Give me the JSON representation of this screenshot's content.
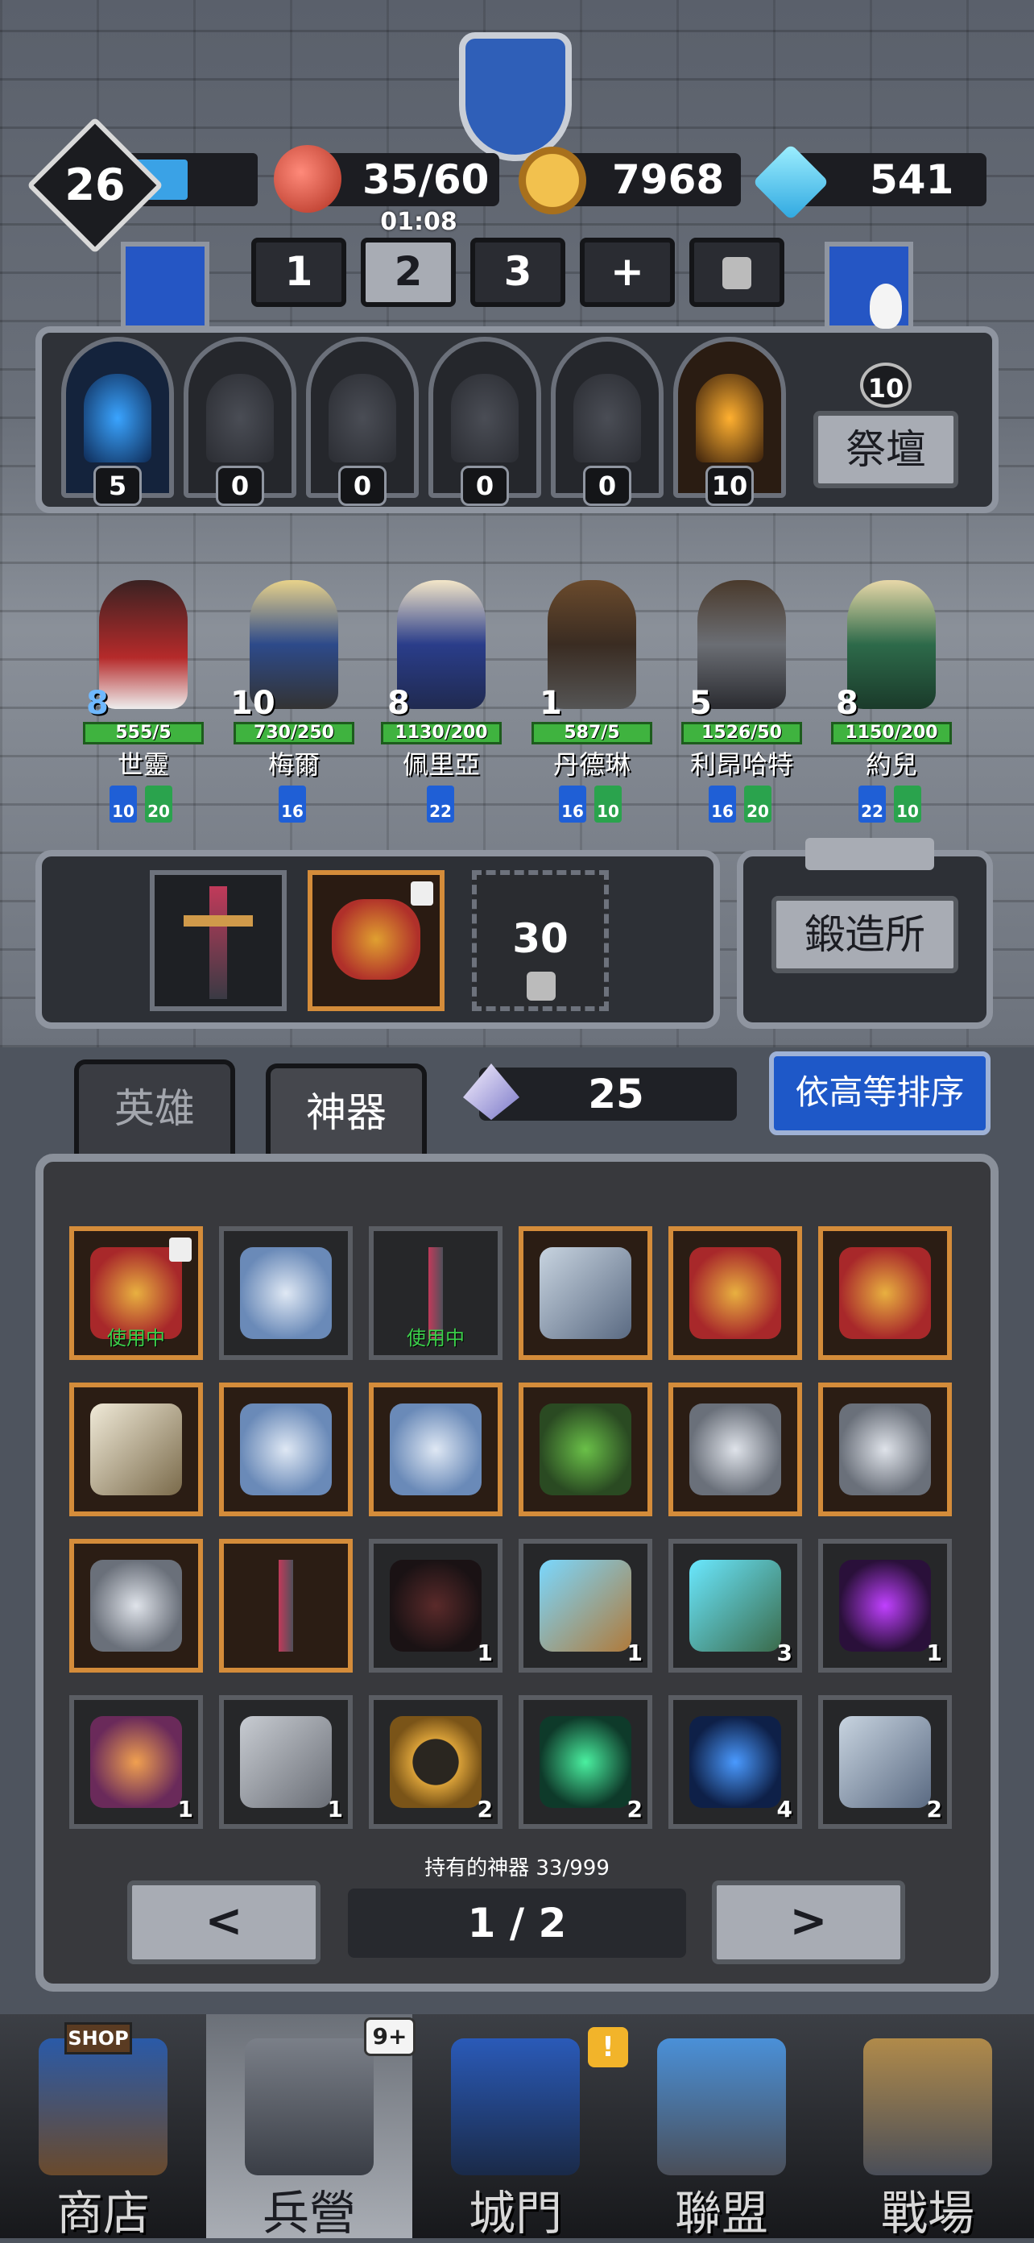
{
  "player": {
    "level": "26",
    "xp_fraction": 0.55
  },
  "resources": {
    "meat": "35/60",
    "meat_timer": "01:08",
    "coins": "7968",
    "gems": "541"
  },
  "teams": {
    "tabs": [
      "1",
      "2",
      "3",
      "+"
    ],
    "selected": "2"
  },
  "altar": {
    "slot_levels": [
      "5",
      "0",
      "0",
      "0",
      "0",
      "10"
    ],
    "level": "10",
    "button_label": "祭壇"
  },
  "heroes": [
    {
      "name": "世靈",
      "level": "8",
      "hp": "555/5",
      "runes": [
        "10",
        "20"
      ]
    },
    {
      "name": "梅爾",
      "level": "10",
      "hp": "730/250",
      "runes": [
        "16"
      ]
    },
    {
      "name": "佩里亞",
      "level": "8",
      "hp": "1130/200",
      "runes": [
        "22"
      ]
    },
    {
      "name": "丹德琳",
      "level": "1",
      "hp": "587/5",
      "runes": [
        "16",
        "10"
      ]
    },
    {
      "name": "利昂哈特",
      "level": "5",
      "hp": "1526/50",
      "runes": [
        "16",
        "20"
      ]
    },
    {
      "name": "約兒",
      "level": "8",
      "hp": "1150/200",
      "runes": [
        "22",
        "10"
      ]
    }
  ],
  "equipment": {
    "locked_level": "30"
  },
  "forge": {
    "label": "鍛造所"
  },
  "tabs": {
    "heroes": "英雄",
    "artifacts": "神器"
  },
  "crystals": "25",
  "sort_label": "依高等排序",
  "artifacts": [
    {
      "icon": "crown-icon",
      "count": "",
      "status": "使用中",
      "locked": true,
      "gold": true
    },
    {
      "icon": "serpent-icon",
      "count": "",
      "status": "",
      "locked": false,
      "gold": false
    },
    {
      "icon": "sword-icon",
      "count": "",
      "status": "使用中",
      "locked": false,
      "gold": false
    },
    {
      "icon": "book-icon",
      "count": "",
      "status": "",
      "locked": false,
      "gold": true
    },
    {
      "icon": "crown-icon",
      "count": "",
      "status": "",
      "locked": false,
      "gold": true
    },
    {
      "icon": "crown-icon",
      "count": "",
      "status": "",
      "locked": false,
      "gold": true
    },
    {
      "icon": "horn-icon",
      "count": "",
      "status": "",
      "locked": false,
      "gold": true
    },
    {
      "icon": "serpent-icon",
      "count": "",
      "status": "",
      "locked": false,
      "gold": true
    },
    {
      "icon": "serpent-icon",
      "count": "",
      "status": "",
      "locked": false,
      "gold": true
    },
    {
      "icon": "herb-icon",
      "count": "",
      "status": "",
      "locked": false,
      "gold": true
    },
    {
      "icon": "armor-icon",
      "count": "",
      "status": "",
      "locked": false,
      "gold": true
    },
    {
      "icon": "armor-icon",
      "count": "",
      "status": "",
      "locked": false,
      "gold": true
    },
    {
      "icon": "armor-icon",
      "count": "",
      "status": "",
      "locked": false,
      "gold": true
    },
    {
      "icon": "sword-icon",
      "count": "",
      "status": "",
      "locked": false,
      "gold": true
    },
    {
      "icon": "hat-icon",
      "count": "1",
      "status": "",
      "locked": false,
      "gold": false
    },
    {
      "icon": "spyglass-icon",
      "count": "1",
      "status": "",
      "locked": false,
      "gold": false
    },
    {
      "icon": "staff-icon",
      "count": "3",
      "status": "",
      "locked": false,
      "gold": false
    },
    {
      "icon": "dark-wing-icon",
      "count": "1",
      "status": "",
      "locked": false,
      "gold": false
    },
    {
      "icon": "magic-wand-icon",
      "count": "1",
      "status": "",
      "locked": false,
      "gold": false
    },
    {
      "icon": "scroll-icon",
      "count": "1",
      "status": "",
      "locked": false,
      "gold": false
    },
    {
      "icon": "ring-icon",
      "count": "2",
      "status": "",
      "locked": false,
      "gold": false
    },
    {
      "icon": "green-relic-icon",
      "count": "2",
      "status": "",
      "locked": false,
      "gold": false
    },
    {
      "icon": "gauntlet-icon",
      "count": "4",
      "status": "",
      "locked": false,
      "gold": false
    },
    {
      "icon": "book-icon",
      "count": "2",
      "status": "",
      "locked": false,
      "gold": false
    }
  ],
  "owned_text": "持有的神器 33/999",
  "pagination": {
    "prev": "<",
    "next": ">",
    "page": "1 / 2"
  },
  "nav": [
    {
      "label": "商店",
      "badge": "SHOP"
    },
    {
      "label": "兵營",
      "badge": "9+"
    },
    {
      "label": "城門",
      "badge": "!"
    },
    {
      "label": "聯盟",
      "badge": ""
    },
    {
      "label": "戰場",
      "badge": ""
    }
  ],
  "colors": {
    "accent_blue": "#1e58c8",
    "hp_green": "#3fb33f",
    "gold_frame": "#d48c3a",
    "in_use_green": "#3bd04a"
  }
}
